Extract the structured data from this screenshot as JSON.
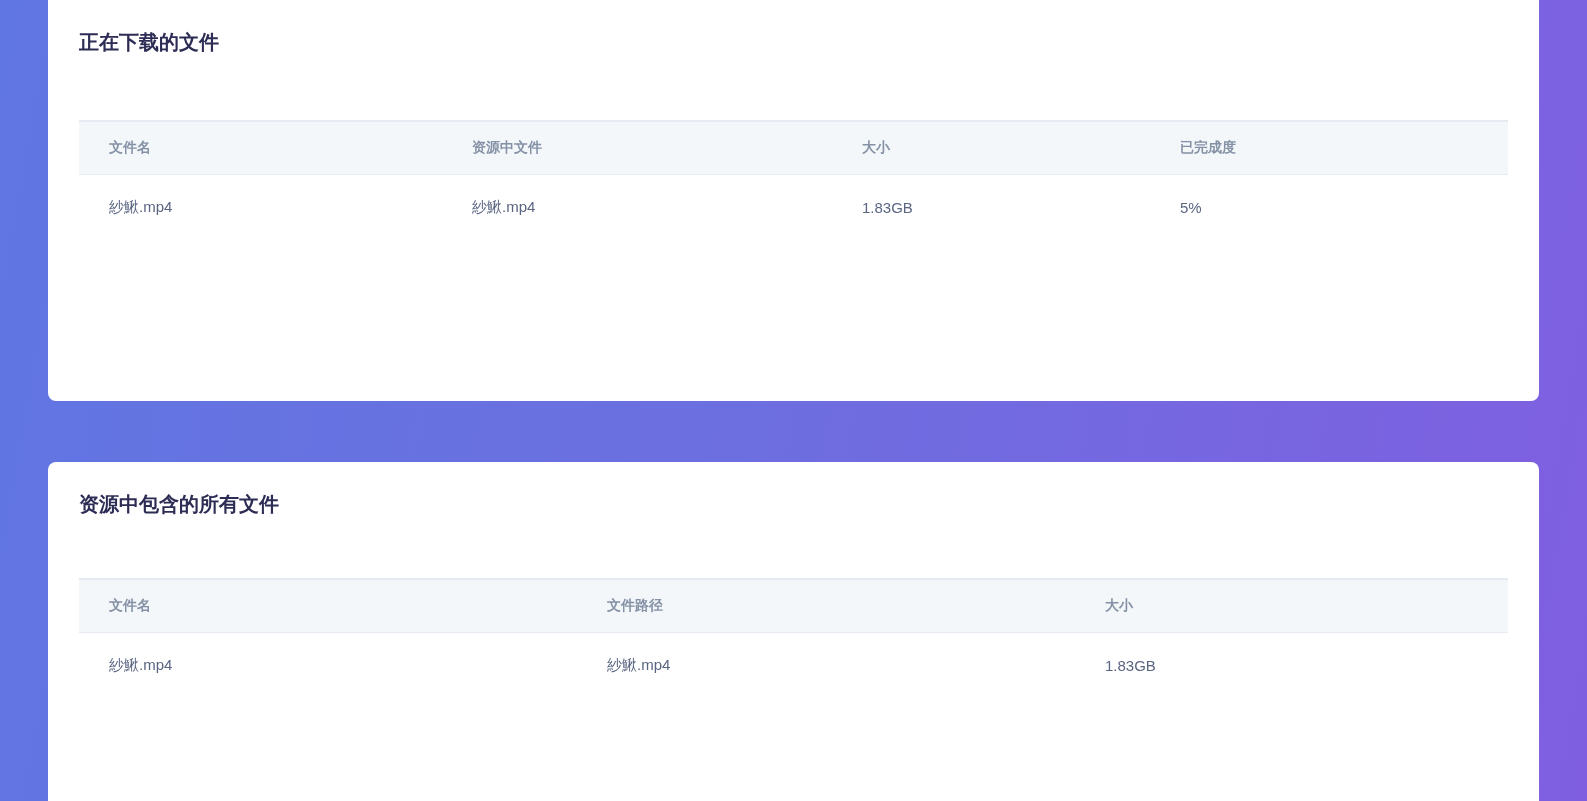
{
  "sections": [
    {
      "title": "正在下载的文件",
      "columns": [
        "文件名",
        "资源中文件",
        "大小",
        "已完成度"
      ],
      "rows": [
        [
          "紗鰍.mp4",
          "紗鰍.mp4",
          "1.83GB",
          "5%"
        ]
      ]
    },
    {
      "title": "资源中包含的所有文件",
      "columns": [
        "文件名",
        "文件路径",
        "大小"
      ],
      "rows": [
        [
          "紗鰍.mp4",
          "紗鰍.mp4",
          "1.83GB"
        ]
      ]
    }
  ]
}
